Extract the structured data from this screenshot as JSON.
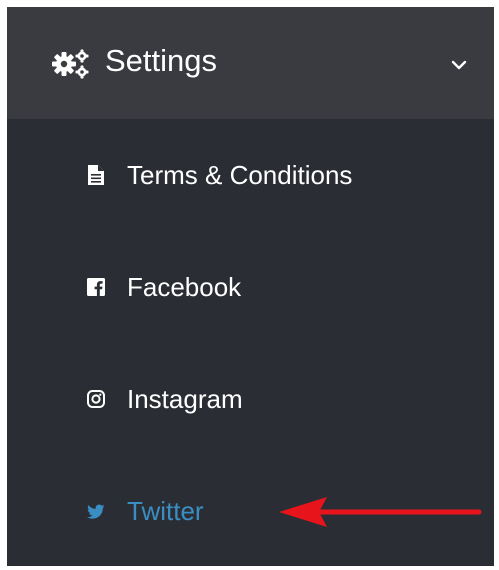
{
  "menu": {
    "title": "Settings",
    "title_icon": "gears-icon",
    "toggle_icon": "chevron-down-icon",
    "expanded": true,
    "items": [
      {
        "label": "Terms & Conditions",
        "icon": "file-text-icon",
        "active": false
      },
      {
        "label": "Facebook",
        "icon": "facebook-icon",
        "active": false
      },
      {
        "label": "Instagram",
        "icon": "instagram-icon",
        "active": false
      },
      {
        "label": "Twitter",
        "icon": "twitter-icon",
        "active": true
      }
    ]
  },
  "annotation": {
    "type": "arrow",
    "points_to": "Twitter",
    "color": "#e8141c"
  },
  "colors": {
    "sidebar_bg": "#2b2d34",
    "header_bg": "#393b41",
    "text": "#ffffff",
    "active_text": "#3b8ec4"
  }
}
